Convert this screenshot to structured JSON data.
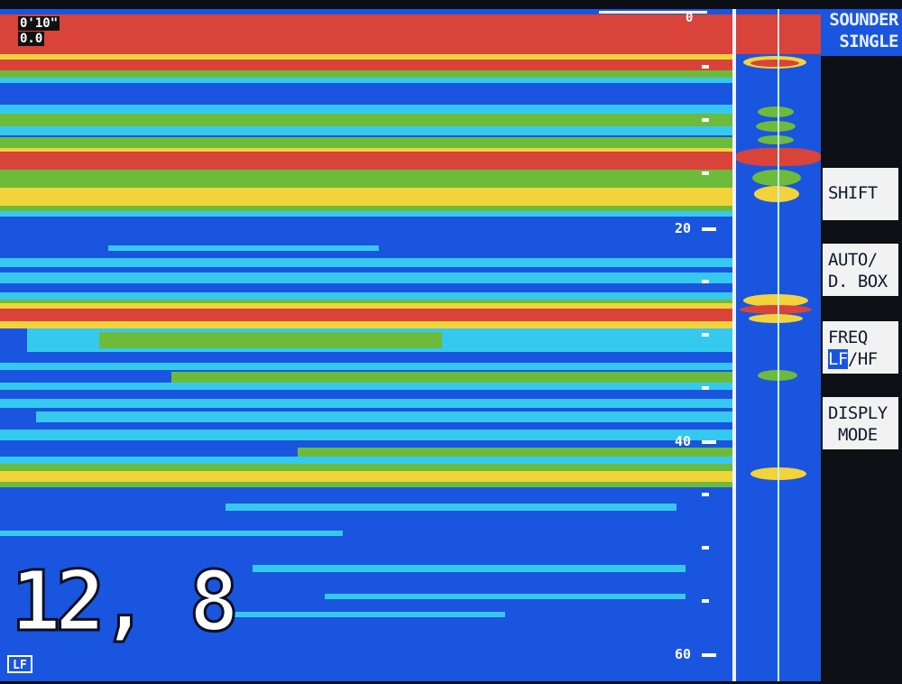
{
  "mode": {
    "line1": "SOUNDER",
    "line2": "SINGLE"
  },
  "softkeys": [
    {
      "line1": "SHIFT",
      "line2": ""
    },
    {
      "line1": "AUTO/",
      "line2": "D. BOX"
    },
    {
      "line1": "FREQ",
      "line2_highlight": "LF",
      "line2_rest": "/HF"
    },
    {
      "line1": "DISPLY",
      "line2": " MODE"
    }
  ],
  "top_info": {
    "line1": "0'10\"",
    "line2": "0.0"
  },
  "top_scale_label": "0",
  "depth_scale": [
    "20",
    "40",
    "60"
  ],
  "depth_reading": "12, 8",
  "frequency_badge": "LF",
  "colors": {
    "background_blue": "#1a55e0",
    "light_blue": "#35c9f0",
    "cyan": "#22d8e8",
    "green": "#6dbb3a",
    "yellow": "#f2d33a",
    "red": "#d9433a",
    "white": "#ffffff",
    "panel_dark": "#0d1014"
  },
  "icons": {
    "frequency_badge_icon": "lf-badge-icon"
  }
}
